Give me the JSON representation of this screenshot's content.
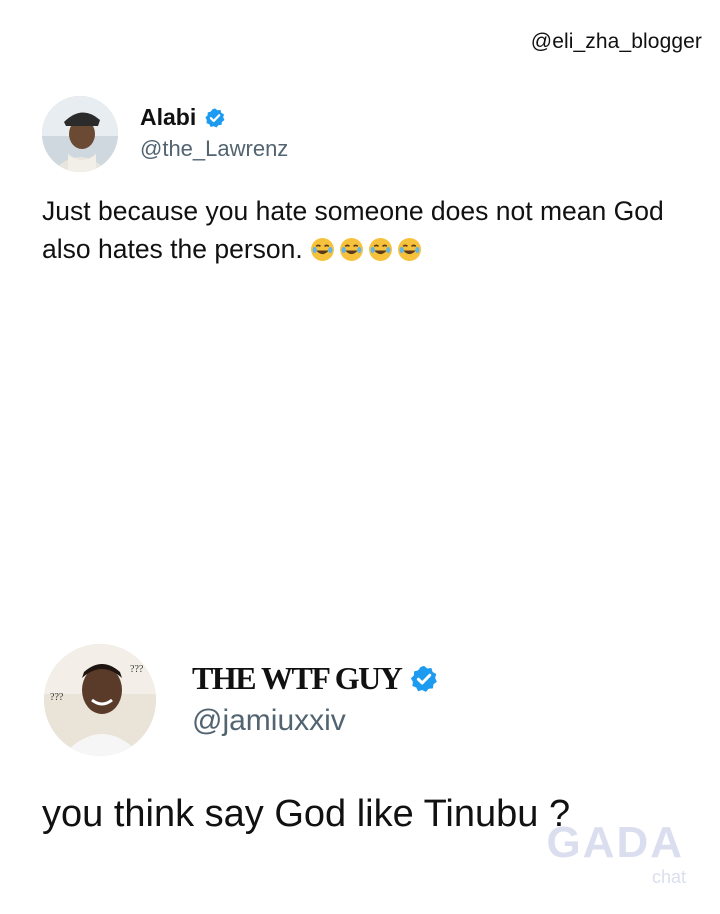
{
  "watermark_handle": "@eli_zha_blogger",
  "tweet1": {
    "name": "Alabi",
    "handle": "@the_Lawrenz",
    "verified": true,
    "text": "Just because you hate someone does not mean God also hates the person.",
    "emoji": [
      "face-with-tears-of-joy",
      "face-with-tears-of-joy",
      "face-with-tears-of-joy",
      "face-with-tears-of-joy"
    ]
  },
  "tweet2": {
    "name": "THE WTF GUY",
    "handle": "@jamiuxxiv",
    "verified": true,
    "text": "you think say God like Tinubu ?"
  },
  "site_watermark": {
    "logo": "GADA",
    "sub": "chat"
  },
  "colors": {
    "verified_blue": "#1d9bf0",
    "handle_gray": "#536471",
    "text": "#111111"
  }
}
